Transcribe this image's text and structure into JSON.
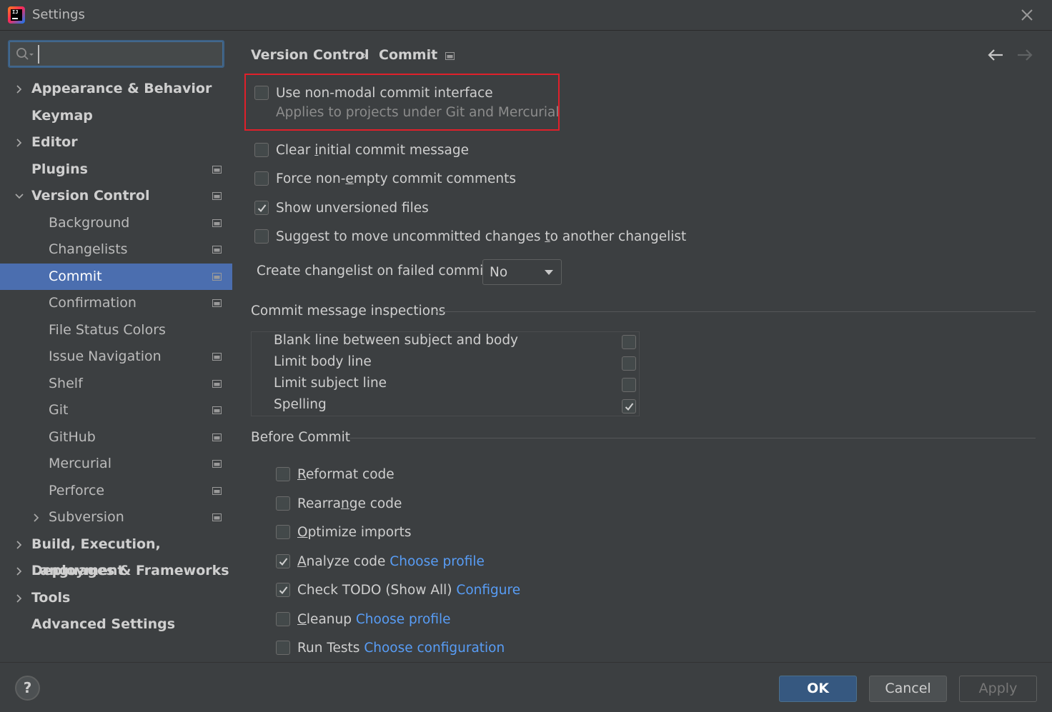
{
  "window": {
    "title": "Settings"
  },
  "search": {
    "placeholder": "",
    "value": ""
  },
  "tree": [
    {
      "label": "Appearance & Behavior",
      "level": 0,
      "expandable": true,
      "expanded": false,
      "project": false
    },
    {
      "label": "Keymap",
      "level": 0,
      "expandable": false,
      "project": false
    },
    {
      "label": "Editor",
      "level": 0,
      "expandable": true,
      "expanded": false,
      "project": false
    },
    {
      "label": "Plugins",
      "level": 0,
      "expandable": false,
      "project": true
    },
    {
      "label": "Version Control",
      "level": 0,
      "expandable": true,
      "expanded": true,
      "project": true
    },
    {
      "label": "Background",
      "level": 1,
      "expandable": false,
      "project": true
    },
    {
      "label": "Changelists",
      "level": 1,
      "expandable": false,
      "project": true
    },
    {
      "label": "Commit",
      "level": 1,
      "expandable": false,
      "project": true,
      "selected": true
    },
    {
      "label": "Confirmation",
      "level": 1,
      "expandable": false,
      "project": true
    },
    {
      "label": "File Status Colors",
      "level": 1,
      "expandable": false,
      "project": false
    },
    {
      "label": "Issue Navigation",
      "level": 1,
      "expandable": false,
      "project": true
    },
    {
      "label": "Shelf",
      "level": 1,
      "expandable": false,
      "project": true
    },
    {
      "label": "Git",
      "level": 1,
      "expandable": false,
      "project": true
    },
    {
      "label": "GitHub",
      "level": 1,
      "expandable": false,
      "project": true
    },
    {
      "label": "Mercurial",
      "level": 1,
      "expandable": false,
      "project": true
    },
    {
      "label": "Perforce",
      "level": 1,
      "expandable": false,
      "project": true
    },
    {
      "label": "Subversion",
      "level": 1,
      "expandable": true,
      "expanded": false,
      "project": true
    },
    {
      "label": "Build, Execution, Deployment",
      "level": 0,
      "expandable": true,
      "expanded": false,
      "project": false
    },
    {
      "label": "Languages & Frameworks",
      "level": 0,
      "expandable": true,
      "expanded": false,
      "project": false
    },
    {
      "label": "Tools",
      "level": 0,
      "expandable": true,
      "expanded": false,
      "project": false
    },
    {
      "label": "Advanced Settings",
      "level": 0,
      "expandable": false,
      "project": false
    }
  ],
  "breadcrumb": {
    "parent": "Version Control",
    "separator": "›",
    "current": "Commit"
  },
  "options": {
    "non_modal": {
      "label": "Use non-modal commit interface",
      "sub": "Applies to projects under Git and Mercurial",
      "checked": false
    },
    "clear_msg": {
      "pre": "Clear ",
      "ul": "i",
      "post": "nitial commit message",
      "checked": false
    },
    "force_comments": {
      "pre": "Force non-",
      "ul": "e",
      "post": "mpty commit comments",
      "checked": false
    },
    "show_unversioned": {
      "label": "Show unversioned files",
      "checked": true
    },
    "suggest_move": {
      "pre": "Suggest to move uncommitted changes ",
      "ul": "t",
      "post": "o another changelist",
      "checked": false
    }
  },
  "failed_commit": {
    "label": "Create changelist on failed commit:",
    "value": "No"
  },
  "inspections": {
    "title": "Commit message inspections",
    "rows": [
      {
        "label": "Blank line between subject and body",
        "checked": false
      },
      {
        "label": "Limit body line",
        "checked": false
      },
      {
        "label": "Limit subject line",
        "checked": false
      },
      {
        "label": "Spelling",
        "checked": true
      }
    ]
  },
  "before_commit": {
    "title": "Before Commit",
    "items": [
      {
        "ul": "R",
        "rest": "eformat code",
        "link": "",
        "checked": false
      },
      {
        "pre": "Rearra",
        "ul": "n",
        "rest": "ge code",
        "link": "",
        "checked": false
      },
      {
        "ul": "O",
        "rest": "ptimize imports",
        "link": "",
        "checked": false
      },
      {
        "ul": "A",
        "rest": "nalyze code",
        "link": "Choose profile",
        "checked": true
      },
      {
        "pre": "Check TODO (Show All)",
        "ul": "",
        "rest": "",
        "link": "Configure",
        "checked": true
      },
      {
        "ul": "C",
        "rest": "leanup",
        "link": "Choose profile",
        "checked": false
      },
      {
        "pre": "Run Tests",
        "ul": "",
        "rest": "",
        "link": "Choose configuration",
        "checked": false
      }
    ]
  },
  "footer": {
    "help": "?",
    "ok": "OK",
    "cancel": "Cancel",
    "apply": "Apply"
  },
  "colors": {
    "selection": "#4b6eaf",
    "link": "#589df6",
    "highlight_box": "#e0202a",
    "ok_button": "#365880"
  }
}
